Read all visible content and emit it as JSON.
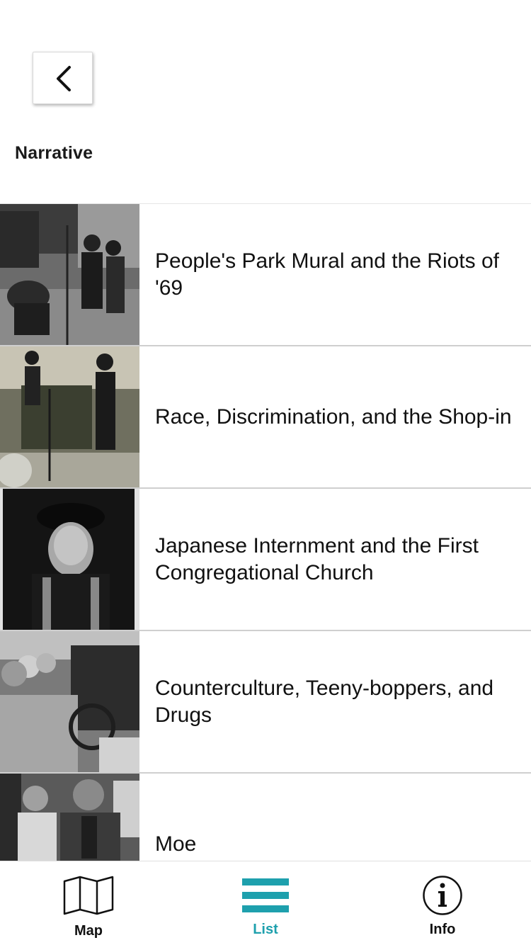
{
  "header": {
    "back_icon": "chevron-left-icon",
    "section_title": "Narrative"
  },
  "list": {
    "items": [
      {
        "title": "People's Park Mural and the Riots of '69",
        "thumbnail": "black-and-white photo of people planting in a park"
      },
      {
        "title": "Race, Discrimination, and the Shop-in",
        "thumbnail": "photo of a woman speaking at a microphone"
      },
      {
        "title": "Japanese Internment and the First Congregational Church",
        "thumbnail": "portrait of an older man in a graduation cap"
      },
      {
        "title": "Counterculture, Teeny-boppers, and Drugs",
        "thumbnail": "photo of young people in a car"
      },
      {
        "title": "Moe",
        "thumbnail": "photo of two men in a shop"
      }
    ]
  },
  "tabbar": {
    "tabs": [
      {
        "label": "Map",
        "icon": "map-icon",
        "active": false
      },
      {
        "label": "List",
        "icon": "list-icon",
        "active": true
      },
      {
        "label": "Info",
        "icon": "info-icon",
        "active": false
      }
    ],
    "active_color": "#1ea0ad"
  }
}
